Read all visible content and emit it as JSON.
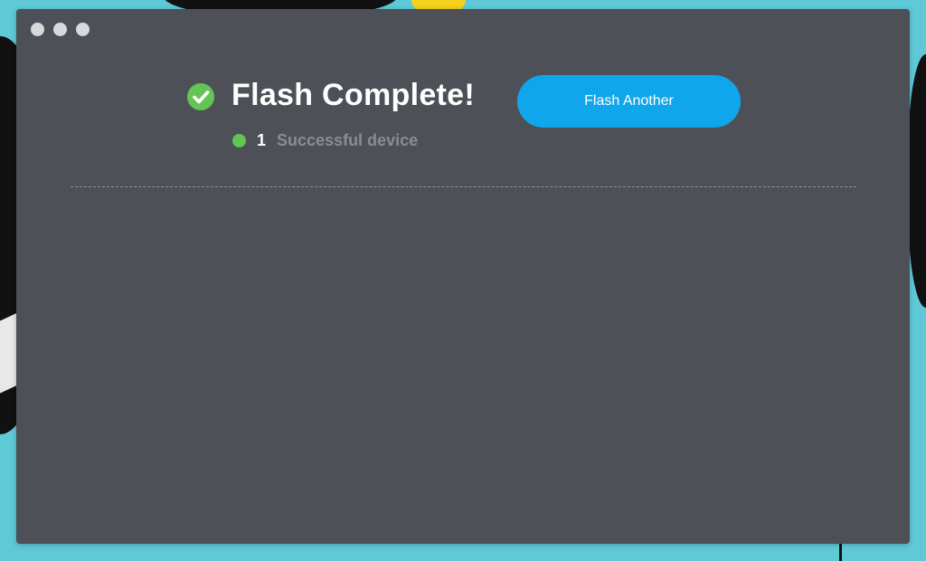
{
  "window": {
    "traffic_lights": [
      "close",
      "minimize",
      "maximize"
    ]
  },
  "result": {
    "title": "Flash Complete!",
    "icon": "check-circle-icon",
    "success_count": "1",
    "success_label": "Successful device"
  },
  "actions": {
    "flash_another_label": "Flash Another"
  },
  "colors": {
    "desktop_background": "#5fc9d8",
    "window_background": "#4e5057",
    "success_green": "#62c554",
    "button_blue": "#0fa6ec",
    "muted_text": "#8a8c92"
  }
}
